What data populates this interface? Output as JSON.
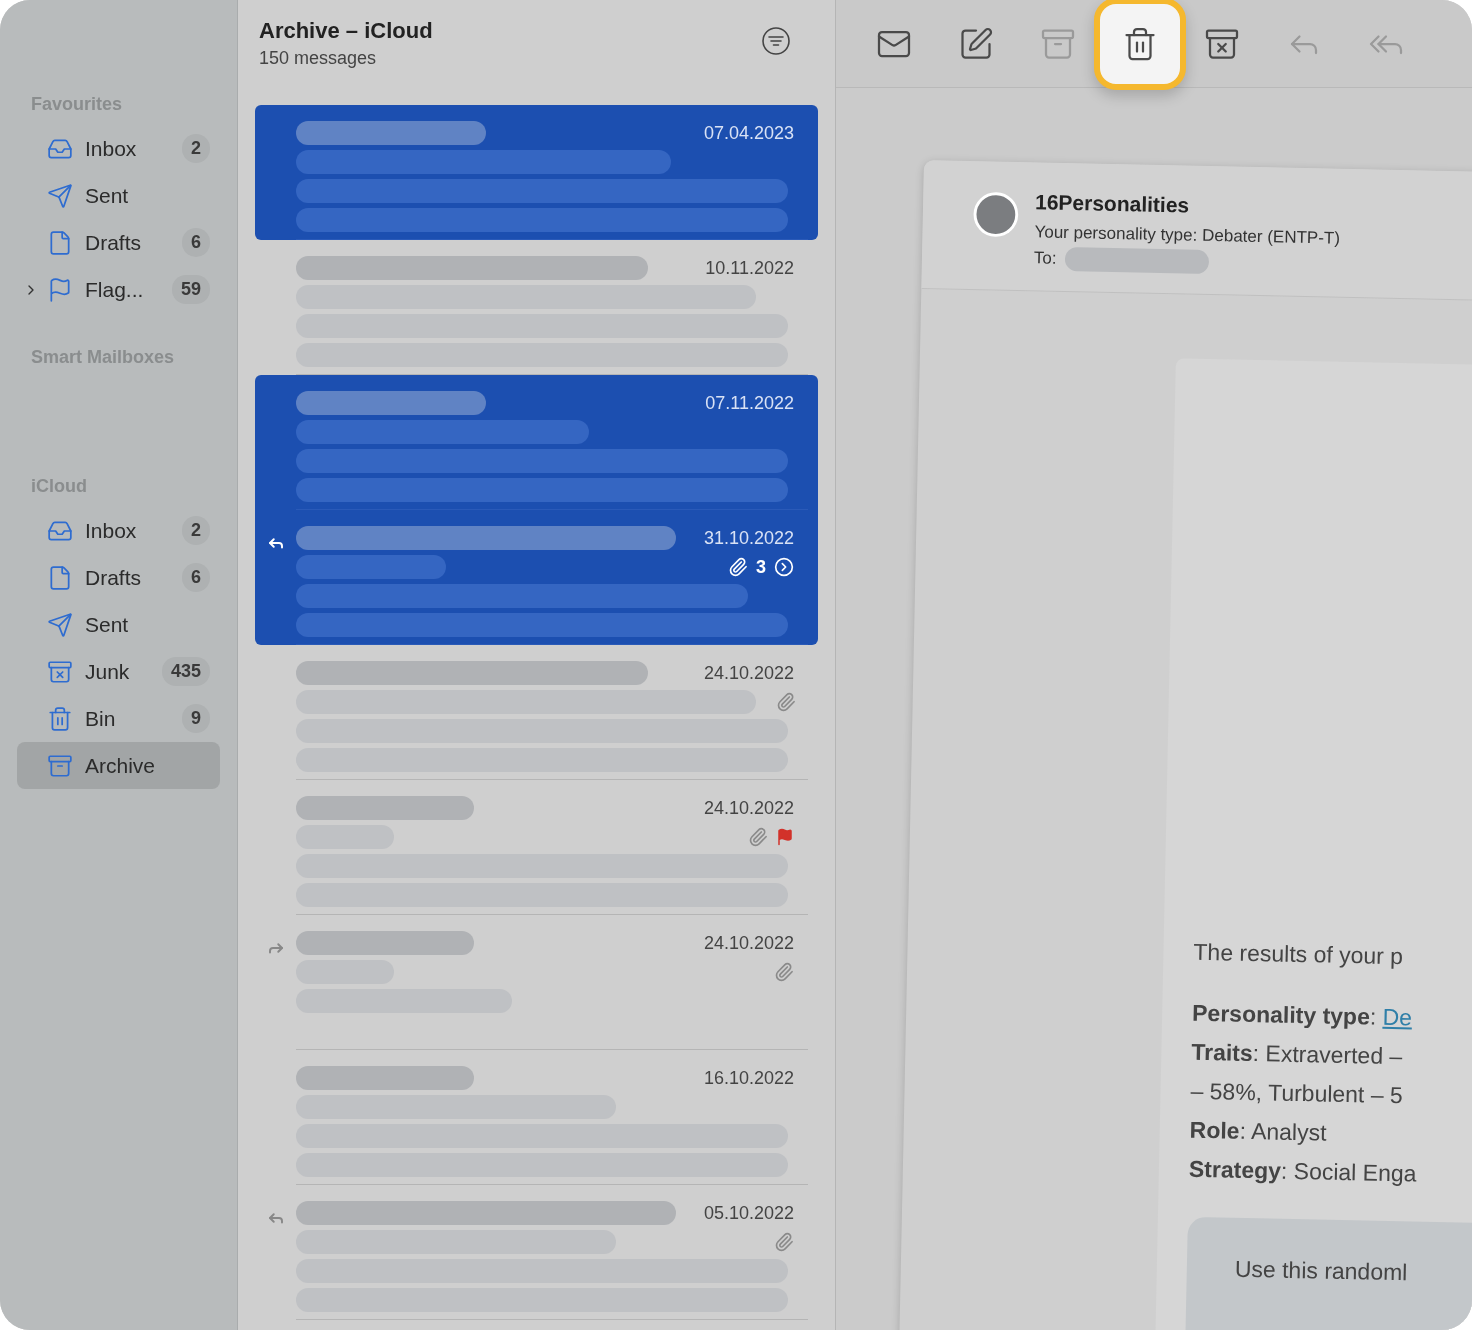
{
  "sidebar": {
    "sections": [
      {
        "title": "Favourites",
        "items": [
          {
            "kind": "inbox",
            "label": "Inbox",
            "count": "2",
            "selected": false
          },
          {
            "kind": "sent",
            "label": "Sent",
            "selected": false
          },
          {
            "kind": "drafts",
            "label": "Drafts",
            "count": "6",
            "selected": false
          },
          {
            "kind": "flag",
            "label": "Flag...",
            "count": "59",
            "selected": false,
            "expanded": false
          }
        ]
      },
      {
        "title": "Smart Mailboxes"
      },
      {
        "title": "iCloud",
        "items": [
          {
            "kind": "inbox",
            "label": "Inbox",
            "count": "2",
            "selected": false
          },
          {
            "kind": "drafts",
            "label": "Drafts",
            "count": "6",
            "selected": false
          },
          {
            "kind": "sent",
            "label": "Sent",
            "selected": false
          },
          {
            "kind": "junk",
            "label": "Junk",
            "count": "435",
            "selected": false
          },
          {
            "kind": "bin",
            "label": "Bin",
            "count": "9",
            "selected": false
          },
          {
            "kind": "archive",
            "label": "Archive",
            "selected": true
          }
        ]
      }
    ]
  },
  "message_list": {
    "title": "Archive – iCloud",
    "subtitle": "150 messages",
    "messages": [
      {
        "date": "07.04.2023",
        "selected": true
      },
      {
        "date": "10.11.2022",
        "selected": false
      },
      {
        "date": "07.11.2022",
        "selected": true
      },
      {
        "date": "31.10.2022",
        "selected": true,
        "replied": true,
        "attachment": true,
        "thread_count": "3"
      },
      {
        "date": "24.10.2022",
        "selected": false,
        "attachment": true
      },
      {
        "date": "24.10.2022",
        "selected": false,
        "attachment": true,
        "flagged": true
      },
      {
        "date": "24.10.2022",
        "selected": false,
        "forwarded": true,
        "attachment": true
      },
      {
        "date": "16.10.2022",
        "selected": false
      },
      {
        "date": "05.10.2022",
        "selected": false,
        "replied": true,
        "attachment": true
      }
    ]
  },
  "toolbar": {
    "buttons": [
      {
        "kind": "get-mail",
        "disabled": false,
        "highlighted": false
      },
      {
        "kind": "compose",
        "disabled": false,
        "highlighted": false
      },
      {
        "kind": "archive",
        "disabled": true,
        "highlighted": false
      },
      {
        "kind": "delete",
        "disabled": false,
        "highlighted": true
      },
      {
        "kind": "junk",
        "disabled": false,
        "highlighted": false
      },
      {
        "kind": "reply",
        "disabled": true,
        "highlighted": false
      },
      {
        "kind": "reply-all",
        "disabled": true,
        "highlighted": false
      }
    ]
  },
  "email": {
    "sender": "16Personalities",
    "subject": "Your personality type: Debater (ENTP-T)",
    "to_label": "To:",
    "intro": "The results of your p",
    "lines": [
      {
        "text": "**Personality type**: ",
        "link": "De"
      },
      {
        "text": "**Traits**: Extraverted –"
      },
      {
        "text": "– 58%, Turbulent – 5"
      },
      {
        "text": "**Role**: Analyst"
      },
      {
        "text": "**Strategy**: Social Enga"
      }
    ],
    "callout": "Use this randoml"
  }
}
